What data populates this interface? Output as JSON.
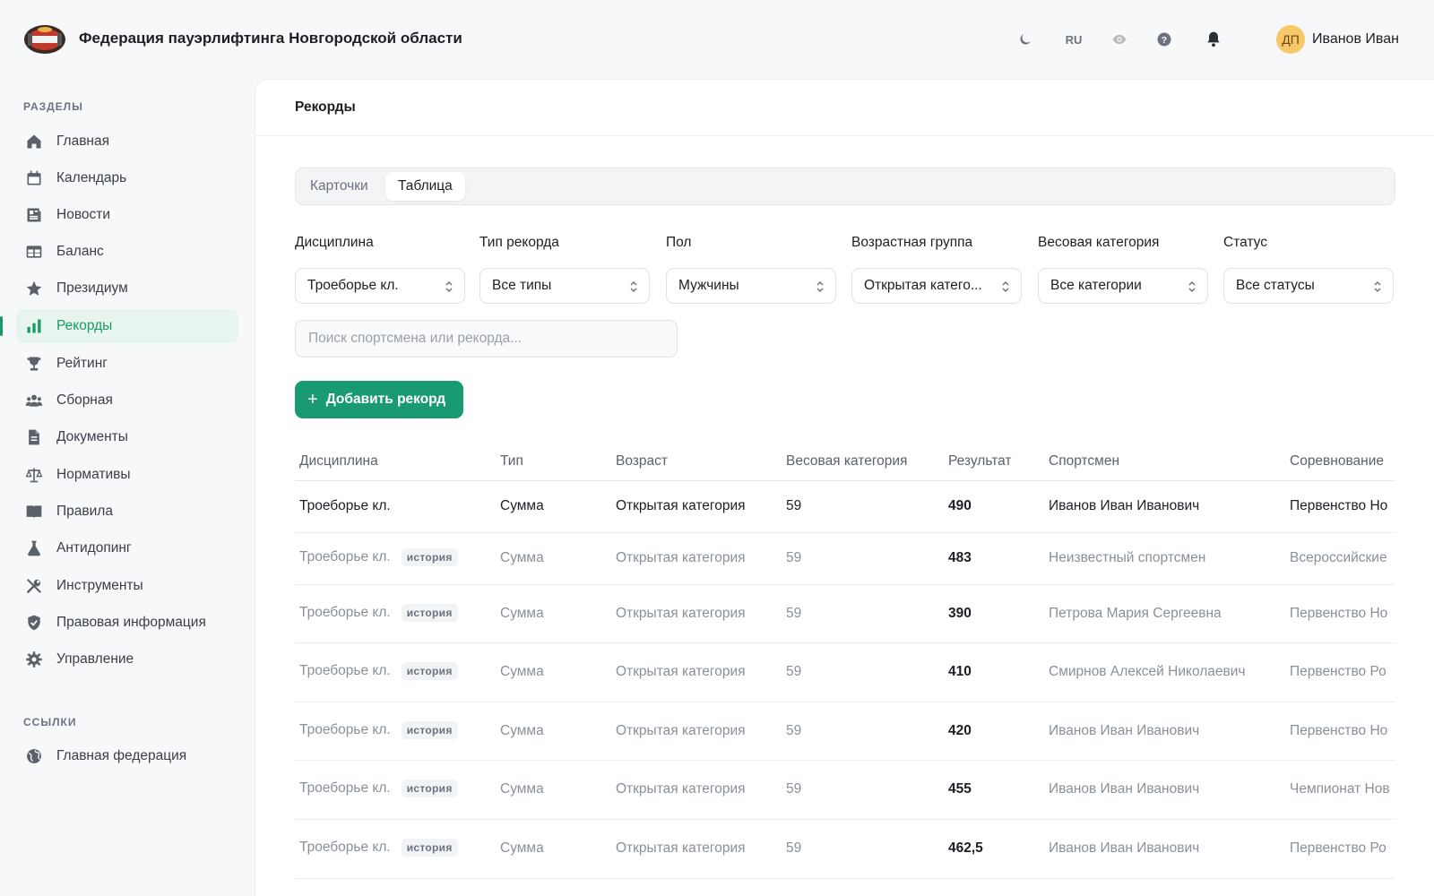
{
  "header": {
    "org_title": "Федерация пауэрлифтинга Новгородской области",
    "lang": "RU",
    "icons": [
      "moon-icon",
      "eye-icon",
      "help-icon",
      "bell-icon"
    ],
    "avatar_initials": "ДП",
    "user_name": "Иванов Иван"
  },
  "sidebar": {
    "sections_title": "РАЗДЕЛЫ",
    "links_title": "ССЫЛКИ",
    "items": [
      {
        "label": "Главная",
        "icon": "home-icon"
      },
      {
        "label": "Календарь",
        "icon": "calendar-icon"
      },
      {
        "label": "Новости",
        "icon": "news-icon"
      },
      {
        "label": "Баланс",
        "icon": "table-icon"
      },
      {
        "label": "Президиум",
        "icon": "star-icon"
      },
      {
        "label": "Рекорды",
        "icon": "bar-chart-icon",
        "active": true
      },
      {
        "label": "Рейтинг",
        "icon": "trophy-icon"
      },
      {
        "label": "Сборная",
        "icon": "users-icon"
      },
      {
        "label": "Документы",
        "icon": "document-icon"
      },
      {
        "label": "Нормативы",
        "icon": "scales-icon"
      },
      {
        "label": "Правила",
        "icon": "book-icon"
      },
      {
        "label": "Антидопинг",
        "icon": "flask-icon"
      },
      {
        "label": "Инструменты",
        "icon": "tools-icon"
      },
      {
        "label": "Правовая информация",
        "icon": "shield-icon"
      },
      {
        "label": "Управление",
        "icon": "gear-icon"
      }
    ],
    "links": [
      {
        "label": "Главная федерация",
        "icon": "globe-icon"
      }
    ]
  },
  "main": {
    "title": "Рекорды",
    "tabs": [
      {
        "label": "Карточки",
        "active": false
      },
      {
        "label": "Таблица",
        "active": true
      }
    ],
    "filters": [
      {
        "label": "Дисциплина",
        "value": "Троеборье кл."
      },
      {
        "label": "Тип рекорда",
        "value": "Все типы"
      },
      {
        "label": "Пол",
        "value": "Мужчины"
      },
      {
        "label": "Возрастная группа",
        "value": "Открытая катего..."
      },
      {
        "label": "Весовая категория",
        "value": "Все категории"
      },
      {
        "label": "Статус",
        "value": "Все статусы"
      }
    ],
    "search_placeholder": "Поиск спортсмена или рекорда...",
    "add_button": "Добавить рекорд"
  },
  "table": {
    "columns": [
      "Дисциплина",
      "Тип",
      "Возраст",
      "Весовая категория",
      "Результат",
      "Спортсмен",
      "Соревнование"
    ],
    "history_badge": "история",
    "rows": [
      {
        "discipline": "Троеборье кл.",
        "history": false,
        "type": "Сумма",
        "age": "Открытая категория",
        "weight": "59",
        "result": "490",
        "athlete": "Иванов Иван Иванович",
        "competition": "Первенство Но"
      },
      {
        "discipline": "Троеборье кл.",
        "history": true,
        "type": "Сумма",
        "age": "Открытая категория",
        "weight": "59",
        "result": "483",
        "athlete": "Неизвестный спортсмен",
        "competition": "Всероссийские"
      },
      {
        "discipline": "Троеборье кл.",
        "history": true,
        "type": "Сумма",
        "age": "Открытая категория",
        "weight": "59",
        "result": "390",
        "athlete": "Петрова Мария Сергеевна",
        "competition": "Первенство Но"
      },
      {
        "discipline": "Троеборье кл.",
        "history": true,
        "type": "Сумма",
        "age": "Открытая категория",
        "weight": "59",
        "result": "410",
        "athlete": "Смирнов Алексей Николаевич",
        "competition": "Первенство Ро"
      },
      {
        "discipline": "Троеборье кл.",
        "history": true,
        "type": "Сумма",
        "age": "Открытая категория",
        "weight": "59",
        "result": "420",
        "athlete": "Иванов Иван Иванович",
        "competition": "Первенство Но"
      },
      {
        "discipline": "Троеборье кл.",
        "history": true,
        "type": "Сумма",
        "age": "Открытая категория",
        "weight": "59",
        "result": "455",
        "athlete": "Иванов Иван Иванович",
        "competition": "Чемпионат Нов"
      },
      {
        "discipline": "Троеборье кл.",
        "history": true,
        "type": "Сумма",
        "age": "Открытая категория",
        "weight": "59",
        "result": "462,5",
        "athlete": "Иванов Иван Иванович",
        "competition": "Первенство Ро"
      }
    ]
  },
  "colors": {
    "accent": "#1a9a72",
    "active_nav_bg": "#e8f5ee",
    "avatar_bg": "#f6c86a"
  }
}
